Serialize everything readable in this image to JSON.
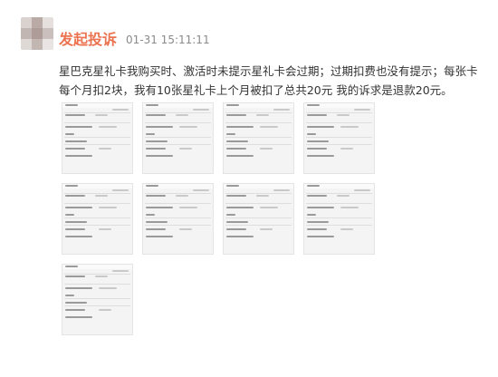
{
  "post": {
    "username": "发起投诉",
    "timestamp": "01-31 15:11:11",
    "text": "星巴克星礼卡我购买时、激活时未提示星礼卡会过期；过期扣费也没有提示；每张卡 每个月扣2块，我有10张星礼卡上个月被扣了总共20元 我的诉求是退款20元。"
  },
  "attachments": {
    "count": 9,
    "items": [
      "screenshot",
      "screenshot",
      "screenshot",
      "screenshot",
      "screenshot",
      "screenshot",
      "screenshot",
      "screenshot",
      "screenshot"
    ]
  }
}
